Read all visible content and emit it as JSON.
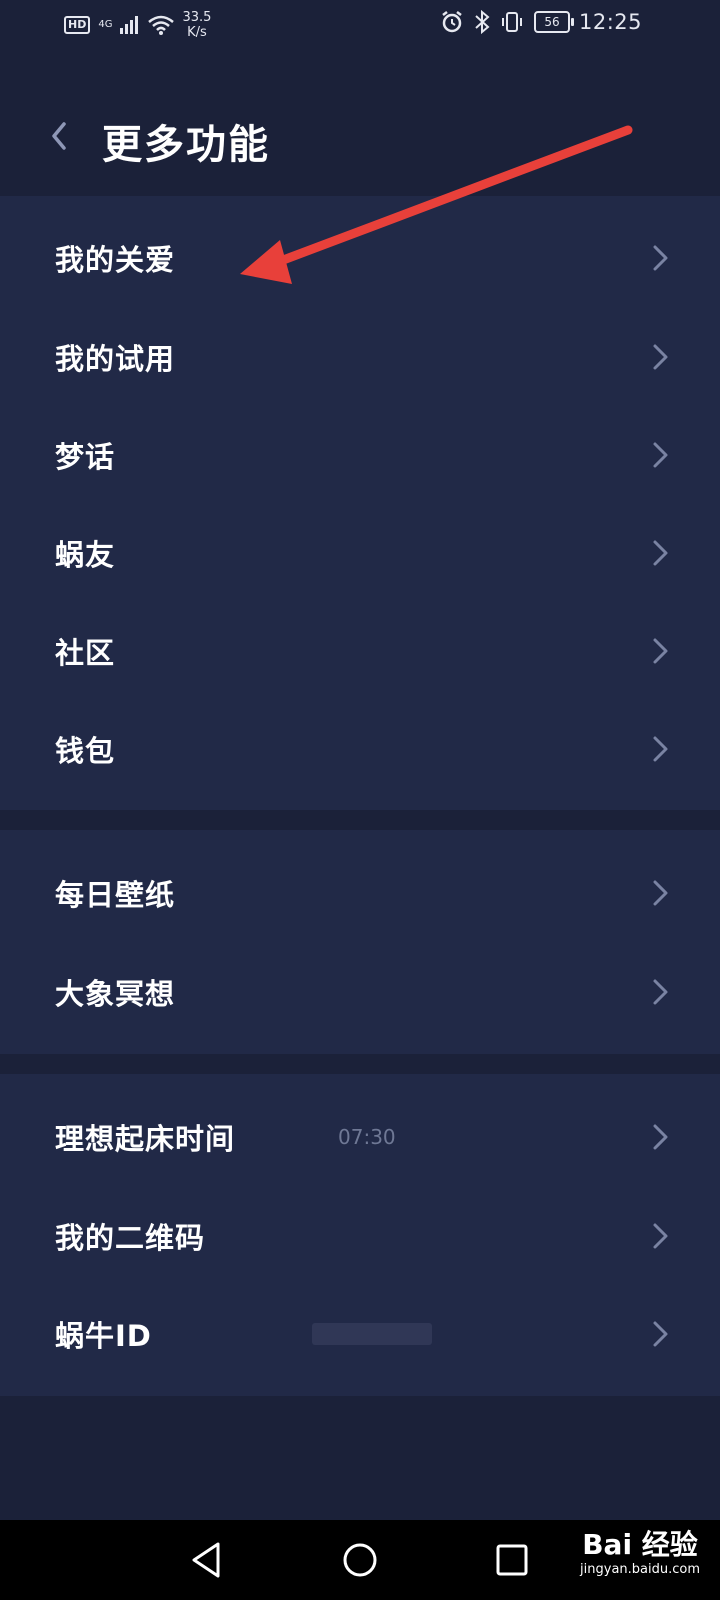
{
  "status_bar": {
    "hd": "HD",
    "network": "4G",
    "speed_value": "33.5",
    "speed_unit": "K/s",
    "battery": "56",
    "time": "12:25"
  },
  "header": {
    "title": "更多功能"
  },
  "sections": [
    {
      "items": [
        {
          "label": "我的关爱"
        },
        {
          "label": "我的试用"
        },
        {
          "label": "梦话"
        },
        {
          "label": "蜗友"
        },
        {
          "label": "社区"
        },
        {
          "label": "钱包"
        }
      ]
    },
    {
      "items": [
        {
          "label": "每日壁纸"
        },
        {
          "label": "大象冥想"
        }
      ]
    },
    {
      "items": [
        {
          "label": "理想起床时间",
          "value": "07:30"
        },
        {
          "label": "我的二维码"
        },
        {
          "label": "蜗牛ID"
        }
      ]
    }
  ],
  "watermark": {
    "main": "Bai 经验",
    "sub": "jingyan.baidu.com"
  },
  "colors": {
    "background": "#1b2139",
    "section": "#212947",
    "annotation_arrow": "#e8403a",
    "muted_text": "#6f7895"
  }
}
